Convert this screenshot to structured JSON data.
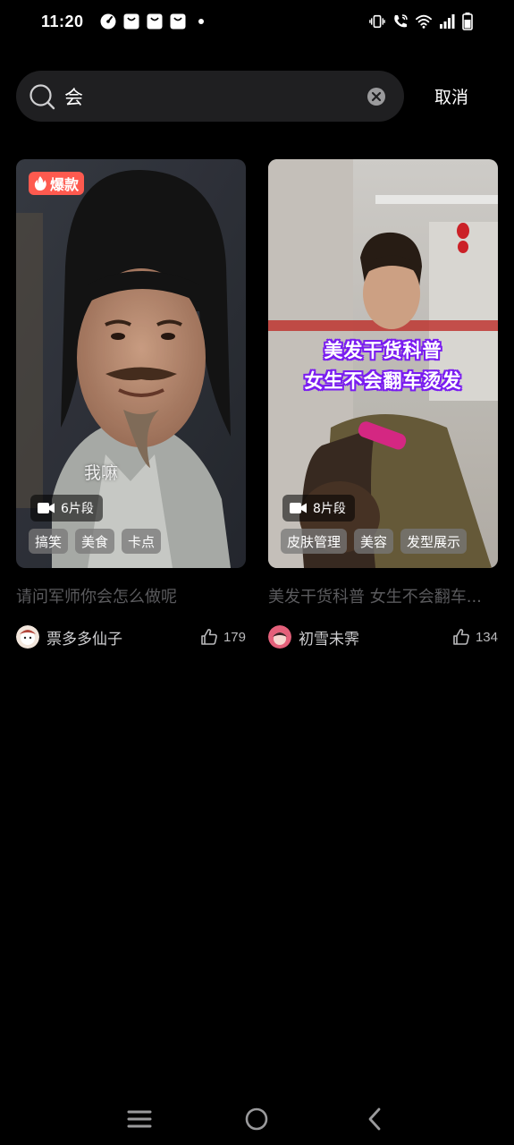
{
  "status_bar": {
    "time": "11:20",
    "left_icons": [
      "app-badge-icon",
      "bag-icon",
      "bag-icon",
      "bag-icon",
      "notification-dot"
    ],
    "right_icons": [
      "vibrate-icon",
      "wifi-call-icon",
      "wifi-icon",
      "signal-icon",
      "battery-icon"
    ]
  },
  "search": {
    "value": "会",
    "cancel_label": "取消"
  },
  "cards": [
    {
      "badge": "爆款",
      "subtitle": "我嘛",
      "overlay_title": [],
      "clips": "6片段",
      "tags": [
        "搞笑",
        "美食",
        "卡点"
      ],
      "title": "请问军师你会怎么做呢",
      "author": "票多多仙子",
      "likes": "179"
    },
    {
      "badge": "",
      "subtitle": "",
      "overlay_title": [
        "美发干货科普",
        "女生不会翻车烫发"
      ],
      "clips": "8片段",
      "tags": [
        "皮肤管理",
        "美容",
        "发型展示"
      ],
      "title": "美发干货科普 女生不会翻车...",
      "author": "初雪未霁",
      "likes": "134"
    }
  ],
  "nav_bar": {
    "icons": [
      "menu-icon",
      "home-icon",
      "back-icon"
    ]
  },
  "colors": {
    "background": "#000000",
    "search_bg": "#1f1f21",
    "hot_badge": "#fe5a4f",
    "overlay_title_outline": "#7a1cf0",
    "title_text": "#5a5a5d"
  }
}
